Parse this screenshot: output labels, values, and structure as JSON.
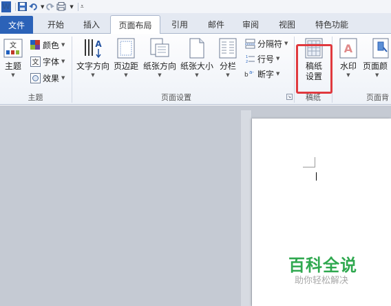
{
  "quick_access": {
    "app_logo": "W",
    "save_icon": "save-icon",
    "undo_icon": "undo-icon",
    "redo_icon": "redo-icon",
    "print_preview_icon": "print-preview-icon",
    "customize_icon": "customize-qat-icon"
  },
  "tabs": [
    {
      "label": "文件"
    },
    {
      "label": "开始"
    },
    {
      "label": "插入"
    },
    {
      "label": "页面布局"
    },
    {
      "label": "引用"
    },
    {
      "label": "邮件"
    },
    {
      "label": "审阅"
    },
    {
      "label": "视图"
    },
    {
      "label": "特色功能"
    }
  ],
  "ribbon": {
    "themes_group": {
      "label": "主题",
      "themes_button": "主题",
      "colors": "颜色",
      "fonts": "字体",
      "effects": "效果"
    },
    "page_setup_group": {
      "label": "页面设置",
      "text_direction": "文字方向",
      "margins": "页边距",
      "orientation": "纸张方向",
      "size": "纸张大小",
      "columns": "分栏",
      "breaks": "分隔符",
      "line_numbers": "行号",
      "hyphenation": "断字"
    },
    "manuscript_group": {
      "label": "稿纸",
      "manuscript_setup_line1": "稿纸",
      "manuscript_setup_line2": "设置"
    },
    "page_background_group": {
      "label": "页面背",
      "watermark": "水印",
      "page_color": "页面颜"
    }
  },
  "colors": {
    "file_tab": "#2b62b8",
    "highlight_box": "#e0393e",
    "watermark_main": "#2fa84f",
    "watermark_sub": "#a8a8a8"
  },
  "watermark": {
    "main": "百科全说",
    "sub": "助你轻松解决"
  }
}
